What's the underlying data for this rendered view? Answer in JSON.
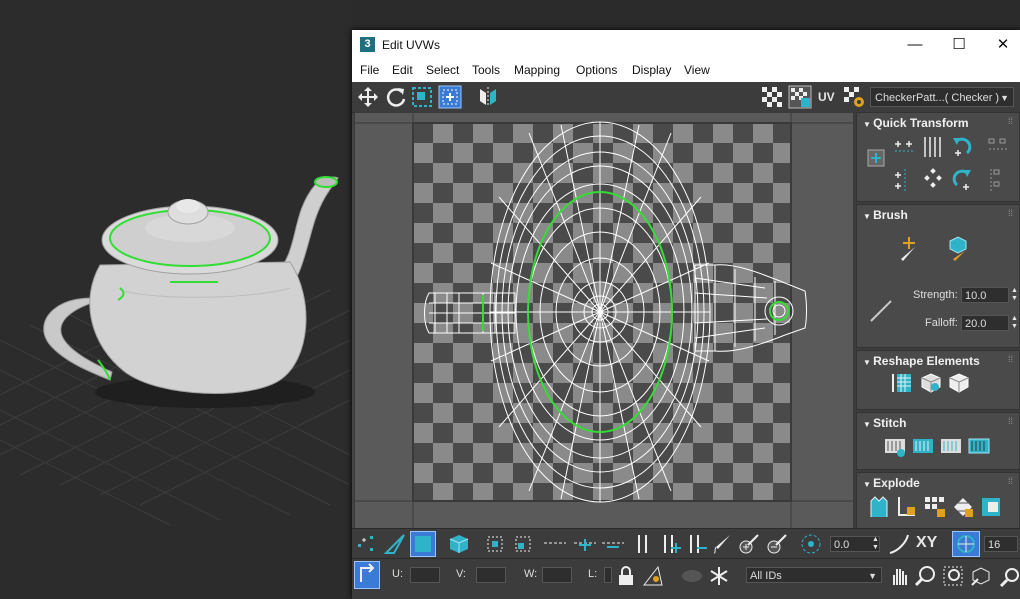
{
  "window": {
    "app_icon": "3",
    "title": "Edit UVWs",
    "controls": [
      "minimize-icon",
      "maximize-icon",
      "close-icon"
    ]
  },
  "menu": [
    "File",
    "Edit",
    "Select",
    "Tools",
    "Mapping",
    "Options",
    "Display",
    "View"
  ],
  "toolbar": {
    "left_icons": [
      "move-icon",
      "rotate-icon",
      "scale-icon",
      "freeform-icon",
      "mirror-icon"
    ],
    "right_icons": [
      "checker-toggle-icon",
      "checker-grid-icon"
    ],
    "uv_label": "UV",
    "settings_icon": "texture-settings-icon",
    "texture_select": "CheckerPatt...( Checker )"
  },
  "rollouts": {
    "quick_transform": {
      "title": "Quick Transform"
    },
    "brush": {
      "title": "Brush",
      "strength_label": "Strength:",
      "strength_value": "10.0",
      "falloff_label": "Falloff:",
      "falloff_value": "20.0"
    },
    "reshape": {
      "title": "Reshape Elements"
    },
    "stitch": {
      "title": "Stitch"
    },
    "explode": {
      "title": "Explode"
    }
  },
  "bottom_bar": {
    "spinner_value": "0.0",
    "xy_label": "XY",
    "grid_value": "16"
  },
  "coords": {
    "u_label": "U:",
    "v_label": "V:",
    "w_label": "W:",
    "l_label": "L:",
    "u_value": "",
    "v_value": "",
    "w_value": "",
    "l_value": "",
    "ids_select": "All IDs"
  },
  "colors": {
    "highlight_green": "#33dd33",
    "accent_cyan": "#2fb3c9",
    "active_blue": "#3a7bd5",
    "checker_dark": "#4a4a4a",
    "checker_light": "#8a8a8a"
  }
}
